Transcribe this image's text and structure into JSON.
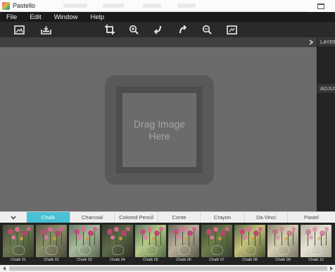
{
  "window": {
    "title": "Pastello"
  },
  "menu": {
    "items": [
      "File",
      "Edit",
      "Window",
      "Help"
    ]
  },
  "toolbar": {
    "buttons": [
      {
        "name": "open-image-icon"
      },
      {
        "name": "save-image-icon"
      },
      {
        "name": "crop-icon"
      },
      {
        "name": "zoom-in-icon"
      },
      {
        "name": "undo-icon"
      },
      {
        "name": "redo-icon"
      },
      {
        "name": "zoom-out-icon"
      },
      {
        "name": "fit-view-icon"
      }
    ]
  },
  "canvas": {
    "drop_text": "Drag Image\nHere"
  },
  "panels": {
    "layers": "LAYERS",
    "adjustments": "ADJUSTMENTS"
  },
  "tabs": {
    "items": [
      "Chalk",
      "Charcoal",
      "Colored Pencil",
      "Conte",
      "Crayon",
      "Da Vinci",
      "Pastel"
    ],
    "active": "Chalk"
  },
  "thumbnails": [
    "Chalk 01",
    "Chalk 02",
    "Chalk 03",
    "Chalk 04",
    "Chalk 05",
    "Chalk 06",
    "Chalk 07",
    "Chalk 08",
    "Chalk 09",
    "Chalk 10"
  ],
  "colors": {
    "accent": "#49c0d4",
    "canvas": "#6b6b6b",
    "toolbar": "#2a2a2a",
    "menubar": "#1b1b1b"
  }
}
